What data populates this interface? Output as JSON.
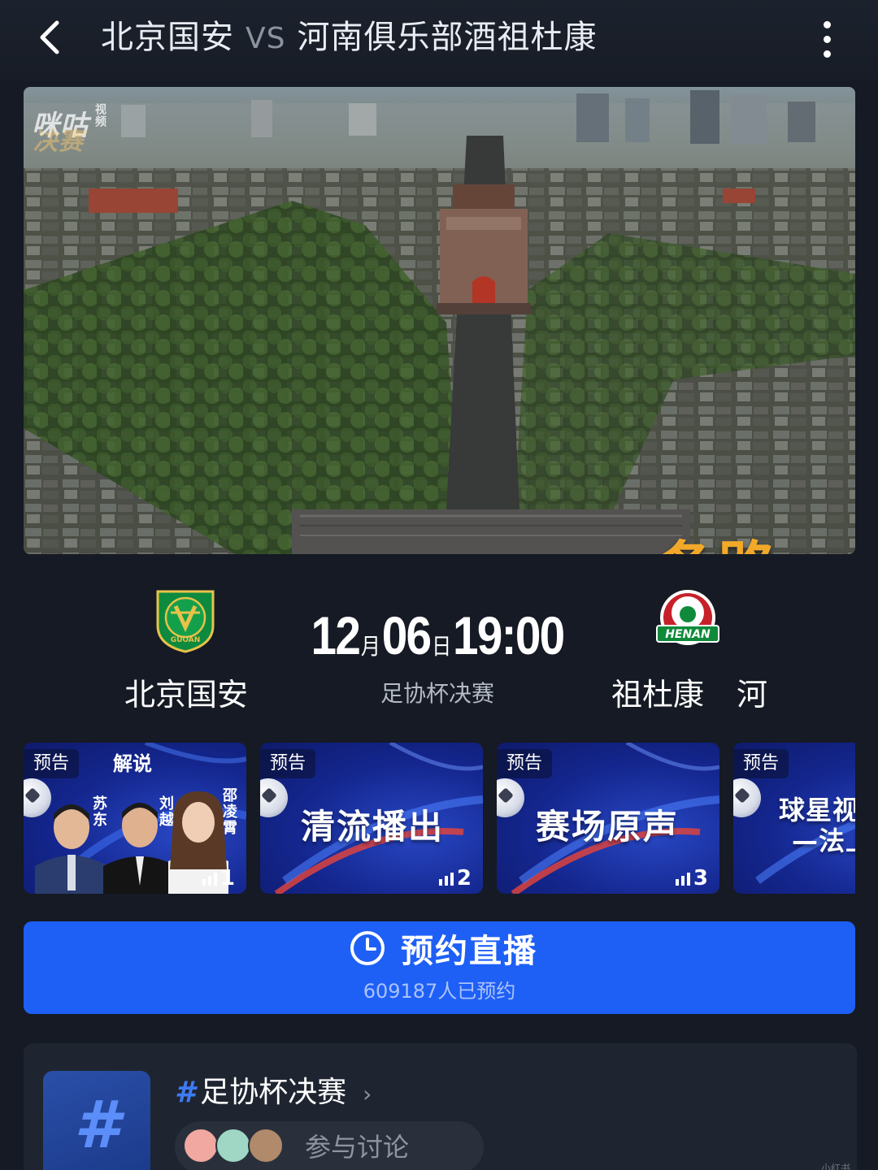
{
  "header": {
    "home_team": "北京国安",
    "vs": "VS",
    "away_team": "河南俱乐部酒祖杜康"
  },
  "video": {
    "watermark": "咪咕",
    "watermark_sub": "视频",
    "watermark_overlay": "决赛",
    "caption": "一条路"
  },
  "match": {
    "month": "12",
    "month_unit": "月",
    "day": "06",
    "day_unit": "日",
    "time": "19:00",
    "competition": "足协杯决赛",
    "home_name": "北京国安",
    "away_name_part1": "祖杜康",
    "away_name_part2": "河",
    "home_logo_text": "GUOAN",
    "away_logo_text": "HENAN"
  },
  "cards": [
    {
      "tag": "预告",
      "title": "解说",
      "commentators": [
        "苏东",
        "刘越",
        "邵凌霄"
      ],
      "number": "1"
    },
    {
      "tag": "预告",
      "headline": "清流播出",
      "number": "2"
    },
    {
      "tag": "预告",
      "headline": "赛场原声",
      "number": "3"
    },
    {
      "tag": "预告",
      "headline_line1": "球星视",
      "headline_line2": "—法上"
    }
  ],
  "reserve": {
    "label": "预约直播",
    "count": "609187人已预约"
  },
  "topic": {
    "hash": "#",
    "title": "足协杯决赛",
    "discuss_label": "参与讨论"
  },
  "corner_watermark": "小红书",
  "colors": {
    "background": "#151a24",
    "accent_blue": "#1e5ff6",
    "card_blue": "#14268e",
    "caption_orange": "#f2a92a"
  }
}
